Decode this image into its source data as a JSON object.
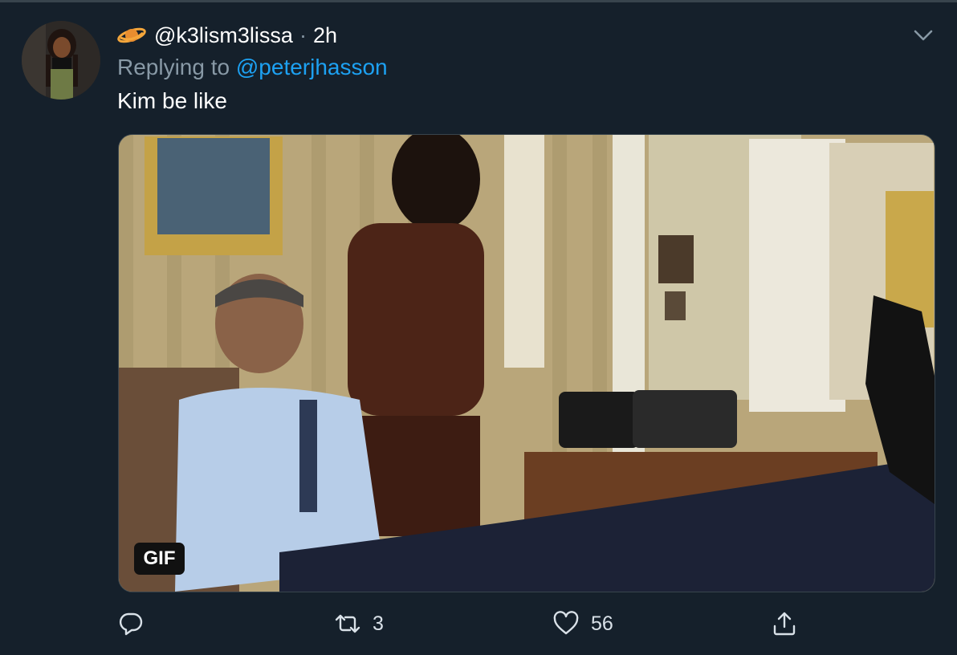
{
  "tweet": {
    "handle": "@k3lism3lissa",
    "separator": "·",
    "time": "2h",
    "replying_prefix": "Replying to ",
    "replying_to": "@peterjhasson",
    "text": "Kim be like",
    "media_badge": "GIF"
  },
  "actions": {
    "reply_count": "",
    "retweet_count": "3",
    "like_count": "56"
  },
  "colors": {
    "background": "#15202b",
    "link": "#1da1f2",
    "secondary": "#8899a6"
  },
  "icons": {
    "reply": "reply-icon",
    "retweet": "retweet-icon",
    "like": "heart-icon",
    "share": "share-icon",
    "more": "chevron-down-icon",
    "emoji": "planet-emoji-icon"
  }
}
